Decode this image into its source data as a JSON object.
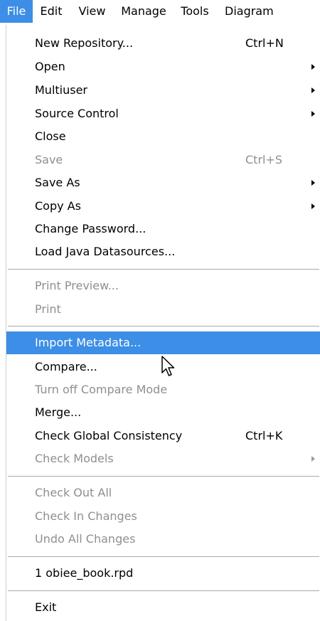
{
  "menubar": {
    "items": [
      {
        "label": "File"
      },
      {
        "label": "Edit"
      },
      {
        "label": "View"
      },
      {
        "label": "Manage"
      },
      {
        "label": "Tools"
      },
      {
        "label": "Diagram"
      }
    ]
  },
  "file_menu": {
    "items": [
      {
        "label": "New Repository...",
        "shortcut": "Ctrl+N"
      },
      {
        "label": "Open"
      },
      {
        "label": "Multiuser"
      },
      {
        "label": "Source Control"
      },
      {
        "label": "Close"
      },
      {
        "label": "Save",
        "shortcut": "Ctrl+S"
      },
      {
        "label": "Save As"
      },
      {
        "label": "Copy As"
      },
      {
        "label": "Change Password..."
      },
      {
        "label": "Load Java Datasources..."
      },
      {
        "label": "Print Preview..."
      },
      {
        "label": "Print"
      },
      {
        "label": "Import Metadata..."
      },
      {
        "label": "Compare..."
      },
      {
        "label": "Turn off Compare Mode"
      },
      {
        "label": "Merge..."
      },
      {
        "label": "Check Global Consistency",
        "shortcut": "Ctrl+K"
      },
      {
        "label": "Check Models"
      },
      {
        "label": "Check Out All"
      },
      {
        "label": "Check In Changes"
      },
      {
        "label": "Undo All Changes"
      },
      {
        "label": "1 obiee_book.rpd"
      },
      {
        "label": "Exit"
      }
    ]
  },
  "colors": {
    "highlight": "#3c8ee6",
    "disabled_text": "#8f8f8f",
    "separator": "#a9a9a9"
  },
  "icons": {
    "submenu": "triangle-right",
    "pointer": "arrow-cursor"
  }
}
